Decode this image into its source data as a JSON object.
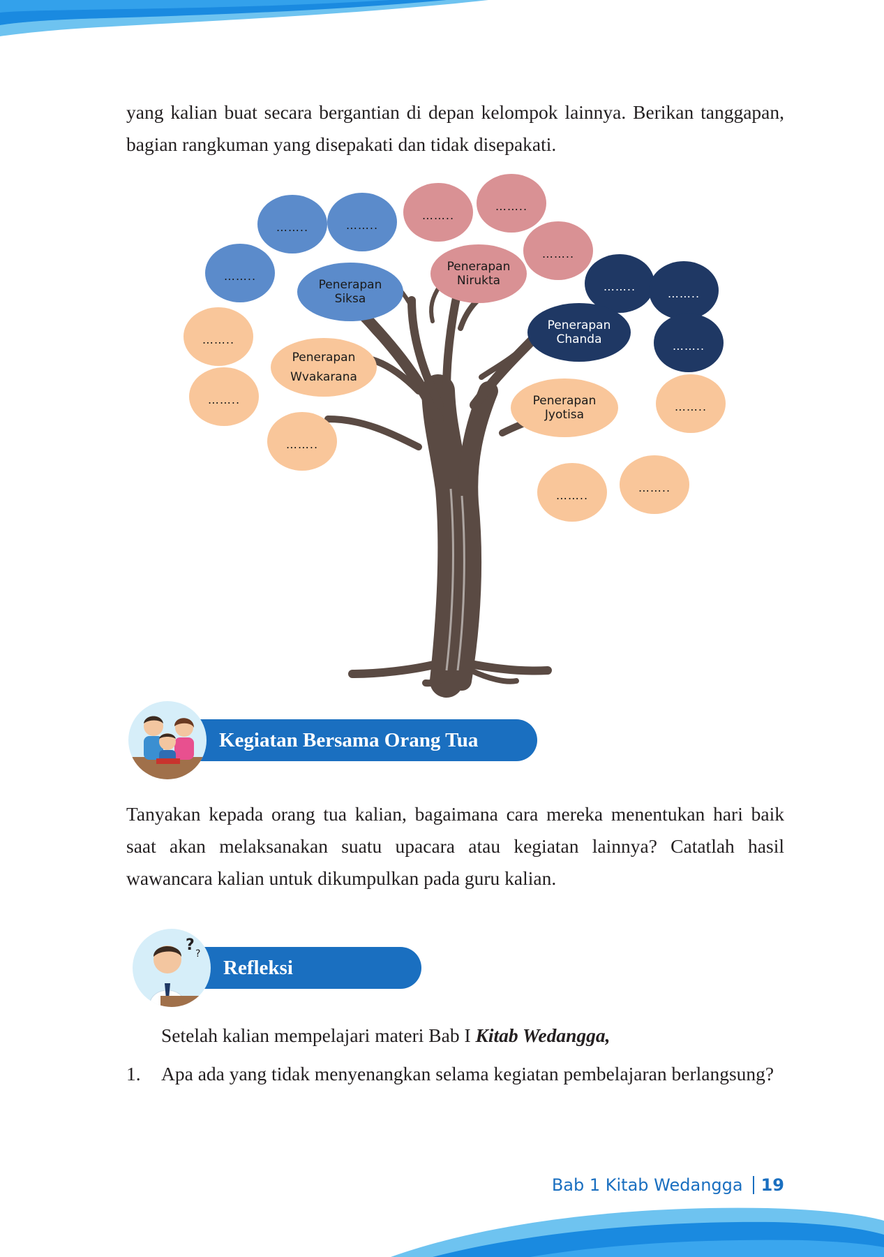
{
  "intro_paragraph": "yang kalian buat secara bergantian di depan kelompok lainnya. Berikan tanggapan, bagian rangkuman yang disepakati dan tidak disepakati.",
  "tree": {
    "placeholder": "……..",
    "labels": {
      "siksa": "Penerapan Siksa",
      "nirukta": "Penerapan Nirukta",
      "chanda": "Penerapan Chanda",
      "wvakarana": "Penerapan Wvakarana",
      "jyotisa": "Penerapan Jyotisa"
    },
    "colors": {
      "blue": "#5b8bcb",
      "pink": "#d99194",
      "navy": "#1f3864",
      "orange": "#f9c69a",
      "trunk": "#5a4a43"
    }
  },
  "section_parents": {
    "title": "Kegiatan Bersama Orang Tua",
    "icon": "family-reading-icon",
    "text": "Tanyakan kepada orang tua kalian, bagaimana cara mereka menentukan hari baik saat akan melaksanakan suatu upacara atau kegiatan lainnya? Catatlah hasil wawancara kalian untuk dikumpulkan pada guru kalian."
  },
  "section_reflection": {
    "title": "Refleksi",
    "icon": "thinking-student-icon",
    "intro_prefix": "Setelah kalian mempelajari materi Bab I ",
    "intro_emphasis": "Kitab Wedangga,",
    "items": [
      {
        "number": "1.",
        "text": "Apa ada yang tidak menyenangkan selama kegiatan pembelajaran berlangsung?"
      }
    ]
  },
  "footer": {
    "chapter": "Bab 1 Kitab Wedangga",
    "page": "19"
  },
  "colors": {
    "accent": "#1a6fc0",
    "wave_light": "#6ec3f0"
  }
}
